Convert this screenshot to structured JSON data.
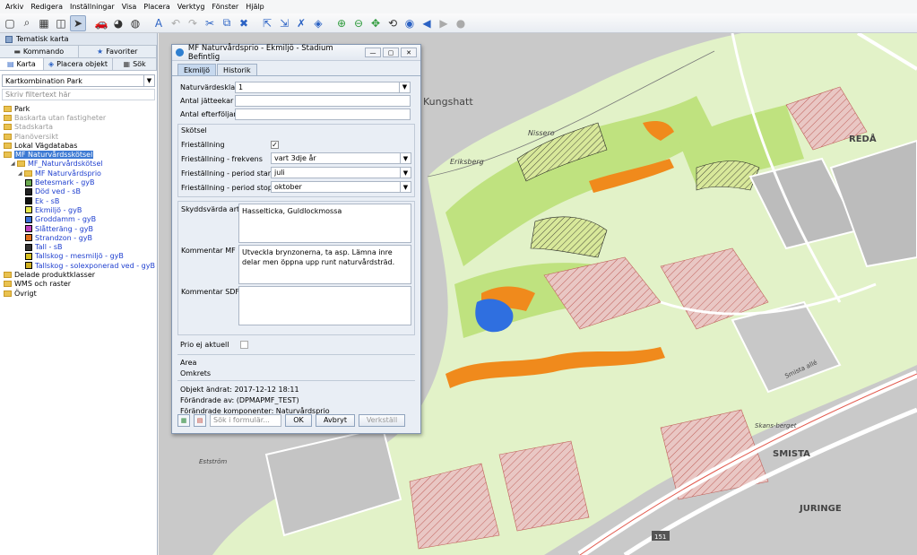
{
  "menu": [
    "Arkiv",
    "Redigera",
    "Inställningar",
    "Visa",
    "Placera",
    "Verktyg",
    "Fönster",
    "Hjälp"
  ],
  "left_panel": {
    "top_tab": "Tematisk karta",
    "tabs_row1": [
      "Kommando",
      "Favoriter"
    ],
    "tabs_row2": [
      "Karta",
      "Placera objekt",
      "Sök"
    ],
    "map_combo": "Kartkombination Park",
    "filter_placeholder": "Skriv filtertext här",
    "tree": [
      {
        "label": "Park",
        "style": "normal",
        "indent": 0,
        "kind": "folder"
      },
      {
        "label": "Baskarta utan fastigheter",
        "style": "gray",
        "indent": 0,
        "kind": "folder"
      },
      {
        "label": "Stadskarta",
        "style": "gray",
        "indent": 0,
        "kind": "folder"
      },
      {
        "label": "Planöversikt",
        "style": "gray",
        "indent": 0,
        "kind": "folder"
      },
      {
        "label": "Lokal Vägdatabas",
        "style": "normal",
        "indent": 0,
        "kind": "folder"
      },
      {
        "label": "MF Naturvårdsskötsel",
        "style": "highlight",
        "indent": 0,
        "kind": "folder"
      },
      {
        "label": "MF_Naturvårdskötsel",
        "style": "blue",
        "indent": 1,
        "kind": "folder"
      },
      {
        "label": "MF Naturvårdsprio",
        "style": "blue",
        "indent": 2,
        "kind": "folder"
      },
      {
        "label": "Betesmark - gyB",
        "style": "blue",
        "indent": 3,
        "kind": "symbol",
        "color": "#6aa84f"
      },
      {
        "label": "Död ved - sB",
        "style": "blue",
        "indent": 3,
        "kind": "symbol",
        "color": "#222222"
      },
      {
        "label": "Ek - sB",
        "style": "blue",
        "indent": 3,
        "kind": "symbol",
        "color": "#111111"
      },
      {
        "label": "Ekmiljö - gyB",
        "style": "blue",
        "indent": 3,
        "kind": "symbol",
        "color": "#e8e84a"
      },
      {
        "label": "Groddamm - gyB",
        "style": "blue",
        "indent": 3,
        "kind": "symbol",
        "color": "#3b6fd6"
      },
      {
        "label": "Slåtteräng - gyB",
        "style": "blue",
        "indent": 3,
        "kind": "symbol",
        "color": "#c040c0"
      },
      {
        "label": "Strandzon - gyB",
        "style": "blue",
        "indent": 3,
        "kind": "symbol",
        "color": "#e0701c"
      },
      {
        "label": "Tall - sB",
        "style": "blue",
        "indent": 3,
        "kind": "symbol",
        "color": "#333333"
      },
      {
        "label": "Tallskog - mesmiljö - gyB",
        "style": "blue",
        "indent": 3,
        "kind": "symbol",
        "color": "#d6c020"
      },
      {
        "label": "Tallskog - solexponerad ved - gyB",
        "style": "blue",
        "indent": 3,
        "kind": "symbol",
        "color": "#d0b020"
      },
      {
        "label": "Delade produktklasser",
        "style": "normal",
        "indent": 0,
        "kind": "folder"
      },
      {
        "label": "WMS och raster",
        "style": "normal",
        "indent": 0,
        "kind": "folder"
      },
      {
        "label": "Övrigt",
        "style": "normal",
        "indent": 0,
        "kind": "folder"
      }
    ]
  },
  "dialog": {
    "title": "MF Naturvårdsprio - Ekmiljö - Stadium Befintlig",
    "tabs": [
      "Ekmiljö",
      "Historik"
    ],
    "fields": {
      "naturvardesklass_label": "Naturvärdesklass",
      "naturvardesklass_value": "1",
      "antal_jatteekar_label": "Antal jätteekar",
      "antal_jatteekar_value": "",
      "antal_efterfoljare_label": "Antal efterföljare",
      "antal_efterfoljare_value": ""
    },
    "skotsel": {
      "group_label": "Skötsel",
      "fristallning_label": "Frieställning",
      "fristallning_checked": true,
      "frekvens_label": "Frieställning - frekvens",
      "frekvens_value": "vart 3dje år",
      "period_start_label": "Frieställning - period start",
      "period_start_value": "juli",
      "period_stopp_label": "Frieställning - period stopp",
      "period_stopp_value": "oktober"
    },
    "skyddsvarda_label": "Skyddsvärda arter",
    "skyddsvarda_value": "Hasselticka, Guldlockmossa",
    "kommentar_mf_label": "Kommentar MF",
    "kommentar_mf_value": "Utveckla brynzonerna, ta asp. Lämna inre delar men öppna  upp runt naturvårdsträd.",
    "kommentar_sdf_label": "Kommentar SDF",
    "kommentar_sdf_value": "",
    "prio_label": "Prio ej aktuell",
    "area_label": "Area",
    "omkrets_label": "Omkrets",
    "objekt_andrat": "Objekt ändrat: 2017-12-12 18:11",
    "forandrade_av": "Förändrade av: (DPMAPMF_TEST)",
    "forandrade_komponenter": "Förändrade komponenter: Naturvårdsprio",
    "search_placeholder": "Sök i formulär...",
    "ok": "OK",
    "avbryt": "Avbryt",
    "verkstall": "Verkställ"
  },
  "map": {
    "labels": [
      "Kungshatt",
      "Nissero",
      "Eriksberg",
      "REDÅ",
      "SMISTA",
      "JURINGE",
      "Smista allé",
      "Skans-berget",
      "Estström",
      "151"
    ]
  }
}
